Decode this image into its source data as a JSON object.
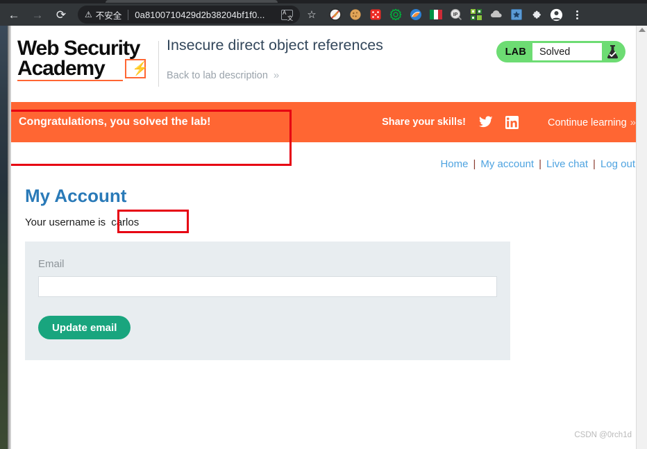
{
  "browser": {
    "back_icon": "back-arrow-icon",
    "forward_icon": "forward-arrow-icon",
    "reload_icon": "reload-icon",
    "back_glyph": "←",
    "forward_glyph": "→",
    "reload_glyph": "⟳",
    "security_label": "不安全",
    "warning_glyph": "⚠",
    "url": "0a8100710429d2b38204bf1f0...",
    "star_glyph": "☆",
    "extensions": [
      {
        "name": "adblock-extension-icon",
        "color": "#f5f5f5"
      },
      {
        "name": "cookie-editor-extension-icon",
        "color": "#e0a458"
      },
      {
        "name": "dice-randomizer-extension-icon",
        "color": "#ee2b24"
      },
      {
        "name": "gear-extension-icon",
        "color": "#00b33c"
      },
      {
        "name": "paint-extension-icon",
        "color": "#2d7fd3"
      },
      {
        "name": "italy-flag-extension-icon",
        "color": "#009246"
      },
      {
        "name": "ip-lookup-extension-icon",
        "color": "#dedede"
      },
      {
        "name": "qr-code-extension-icon",
        "color": "#8dc63f"
      },
      {
        "name": "cloud-extension-icon",
        "color": "#c4c4c4"
      },
      {
        "name": "bookmark-star-extension-icon",
        "color": "#5b9bd5"
      },
      {
        "name": "puzzle-extensions-icon",
        "color": "#e8eaed"
      },
      {
        "name": "profile-avatar-icon",
        "color": "#ffffff"
      }
    ],
    "menu_icon": "three-dot-menu-icon"
  },
  "header": {
    "logo_line1": "Web Security",
    "logo_line2": "Academy",
    "logo_bolt_glyph": "⚡",
    "lab_title": "Insecure direct object references",
    "back_to_lab": "Back to lab description",
    "back_chevrons": "»",
    "lab_widget": {
      "tag": "LAB",
      "status": "Solved",
      "flask_icon": "flask-check-icon",
      "pill_color": "#6ddc73"
    }
  },
  "banner": {
    "message": "Congratulations, you solved the lab!",
    "share_label": "Share your skills!",
    "twitter_icon": "twitter-icon",
    "linkedin_icon": "linkedin-icon",
    "continue_label": "Continue learning",
    "continue_chevrons": "»",
    "background_color": "#ff6633"
  },
  "annotations": {
    "highlight_color": "#e60012",
    "banner_box_name": "annotation-box-banner",
    "username_box_name": "annotation-box-username"
  },
  "top_nav": {
    "items": [
      "Home",
      "My account",
      "Live chat",
      "Log out"
    ],
    "separator": "|",
    "link_color": "#4ea3e0"
  },
  "main": {
    "page_title": "My Account",
    "username_prefix": "Your username is",
    "username": "carlos",
    "form": {
      "email_label": "Email",
      "email_value": "",
      "email_placeholder": "",
      "submit_label": "Update email",
      "submit_color": "#19a57e",
      "panel_color": "#e8edf0"
    }
  },
  "watermark": "CSDN @0rch1d"
}
